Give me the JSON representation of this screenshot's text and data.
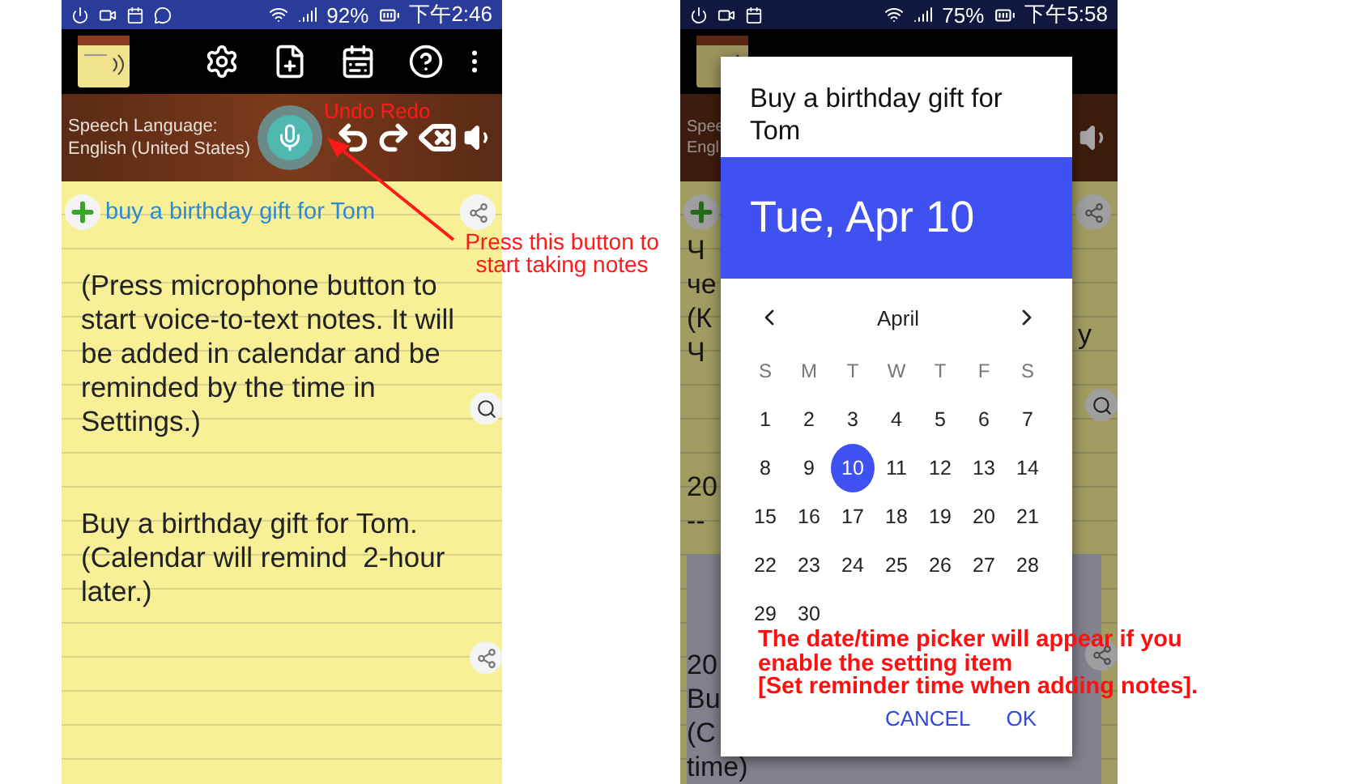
{
  "left_phone": {
    "status_bar": {
      "battery": "92%",
      "time": "下午2:46"
    },
    "speech_bar": {
      "label": "Speech Language:",
      "language": "English (United States)"
    },
    "note_title": "buy a birthday gift for Tom",
    "notes": [
      "(Press microphone button to start voice-to-text notes. It will be added in calendar and be reminded by the time in Settings.)",
      "Buy a birthday gift for Tom.",
      "(Calendar will remind  2-hour later.)"
    ]
  },
  "annotations": [
    {
      "kind": "label",
      "text": "Undo Redo"
    },
    {
      "kind": "callout",
      "text": "Press this button to start taking notes"
    }
  ],
  "right_phone": {
    "status_bar": {
      "battery": "75%",
      "time": "下午5:58"
    },
    "background_speech": [
      "Spee",
      "Engl"
    ],
    "background_lines": [
      "Ч",
      "че",
      "(К",
      "Ч"
    ],
    "background_right": "y",
    "background_entries": [
      "20",
      "--"
    ],
    "background_highlight": [
      "20",
      "Bu",
      "(C",
      "time)"
    ],
    "dialog": {
      "title": "Buy a birthday gift for Tom",
      "date": "Tue, Apr 10",
      "month": "April",
      "weekdays": [
        "S",
        "M",
        "T",
        "W",
        "T",
        "F",
        "S"
      ],
      "days": [
        {
          "label": "1",
          "selected": false
        },
        {
          "label": "2",
          "selected": false
        },
        {
          "label": "3",
          "selected": false
        },
        {
          "label": "4",
          "selected": false
        },
        {
          "label": "5",
          "selected": false
        },
        {
          "label": "6",
          "selected": false
        },
        {
          "label": "7",
          "selected": false
        },
        {
          "label": "8",
          "selected": false
        },
        {
          "label": "9",
          "selected": false
        },
        {
          "label": "10",
          "selected": true
        },
        {
          "label": "11",
          "selected": false
        },
        {
          "label": "12",
          "selected": false
        },
        {
          "label": "13",
          "selected": false
        },
        {
          "label": "14",
          "selected": false
        },
        {
          "label": "15",
          "selected": false
        },
        {
          "label": "16",
          "selected": false
        },
        {
          "label": "17",
          "selected": false
        },
        {
          "label": "18",
          "selected": false
        },
        {
          "label": "19",
          "selected": false
        },
        {
          "label": "20",
          "selected": false
        },
        {
          "label": "21",
          "selected": false
        },
        {
          "label": "22",
          "selected": false
        },
        {
          "label": "23",
          "selected": false
        },
        {
          "label": "24",
          "selected": false
        },
        {
          "label": "25",
          "selected": false
        },
        {
          "label": "26",
          "selected": false
        },
        {
          "label": "27",
          "selected": false
        },
        {
          "label": "28",
          "selected": false
        },
        {
          "label": "29",
          "selected": false
        },
        {
          "label": "30",
          "selected": false
        }
      ],
      "buttons": [
        "CANCEL",
        "OK"
      ]
    }
  },
  "picker_note": [
    "The date/time picker will appear if you",
    "enable the setting item",
    "[Set reminder time when adding notes]."
  ]
}
